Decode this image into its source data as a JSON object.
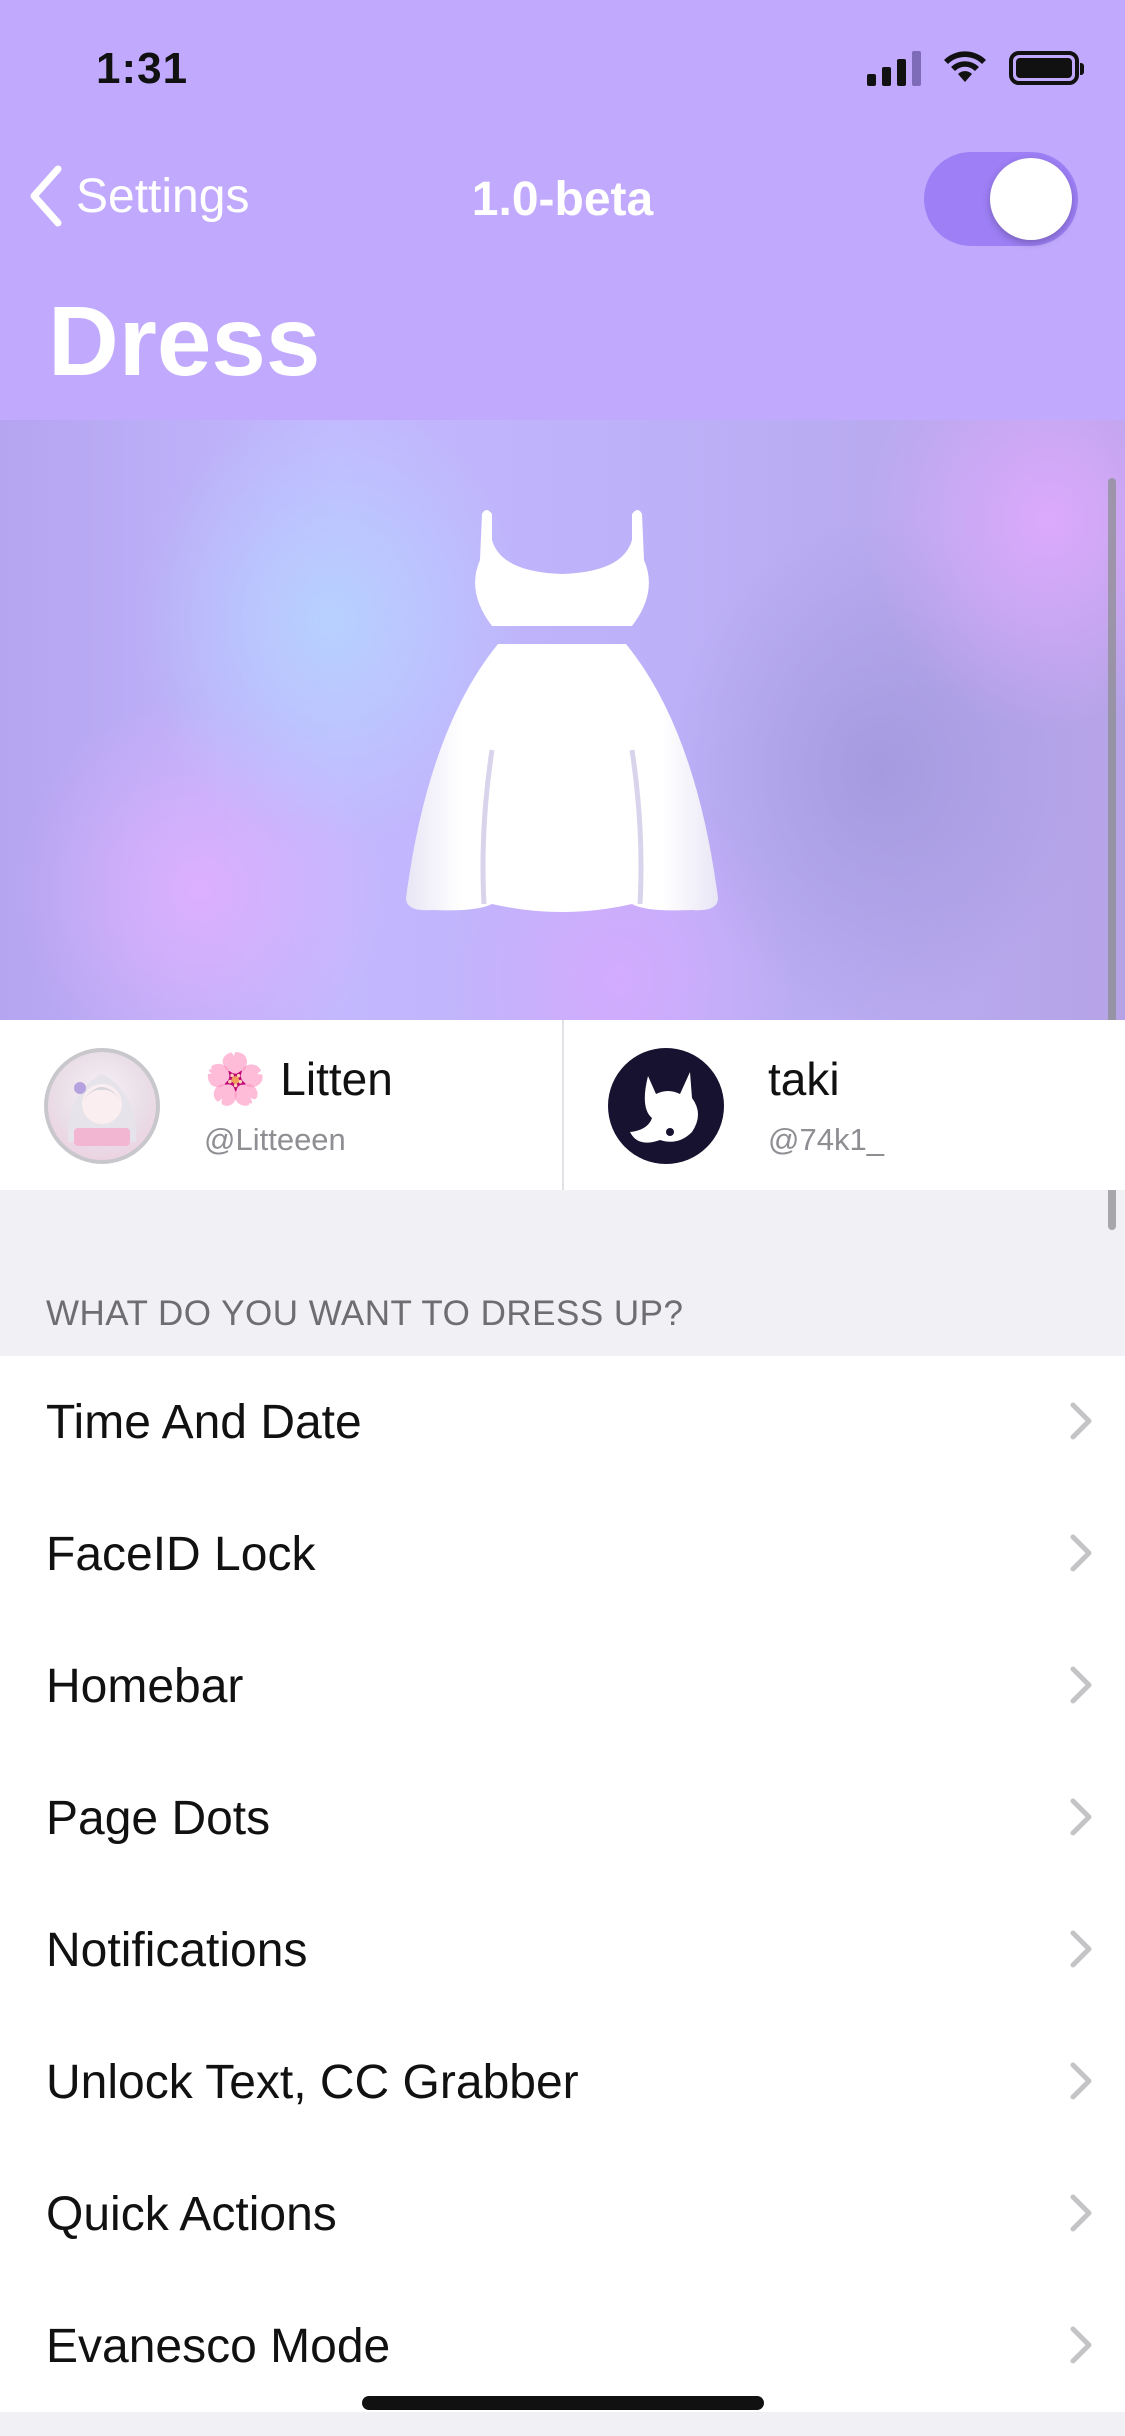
{
  "status_bar": {
    "time": "1:31"
  },
  "nav": {
    "back_label": "Settings",
    "title": "1.0-beta",
    "toggle_on": true
  },
  "page": {
    "large_title": "Dress"
  },
  "authors": [
    {
      "emoji": "🌸",
      "name": "Litten",
      "handle": "@Litteeen"
    },
    {
      "name": "taki",
      "handle": "@74k1_"
    }
  ],
  "section": {
    "header": "WHAT DO YOU WANT TO DRESS UP?",
    "items": [
      {
        "label": "Time And Date"
      },
      {
        "label": "FaceID Lock"
      },
      {
        "label": "Homebar"
      },
      {
        "label": "Page Dots"
      },
      {
        "label": "Notifications"
      },
      {
        "label": "Unlock Text, CC Grabber"
      },
      {
        "label": "Quick Actions"
      },
      {
        "label": "Evanesco Mode"
      }
    ]
  },
  "colors": {
    "header_bg": "#c1aafe",
    "toggle_on": "#9e7ff6"
  }
}
